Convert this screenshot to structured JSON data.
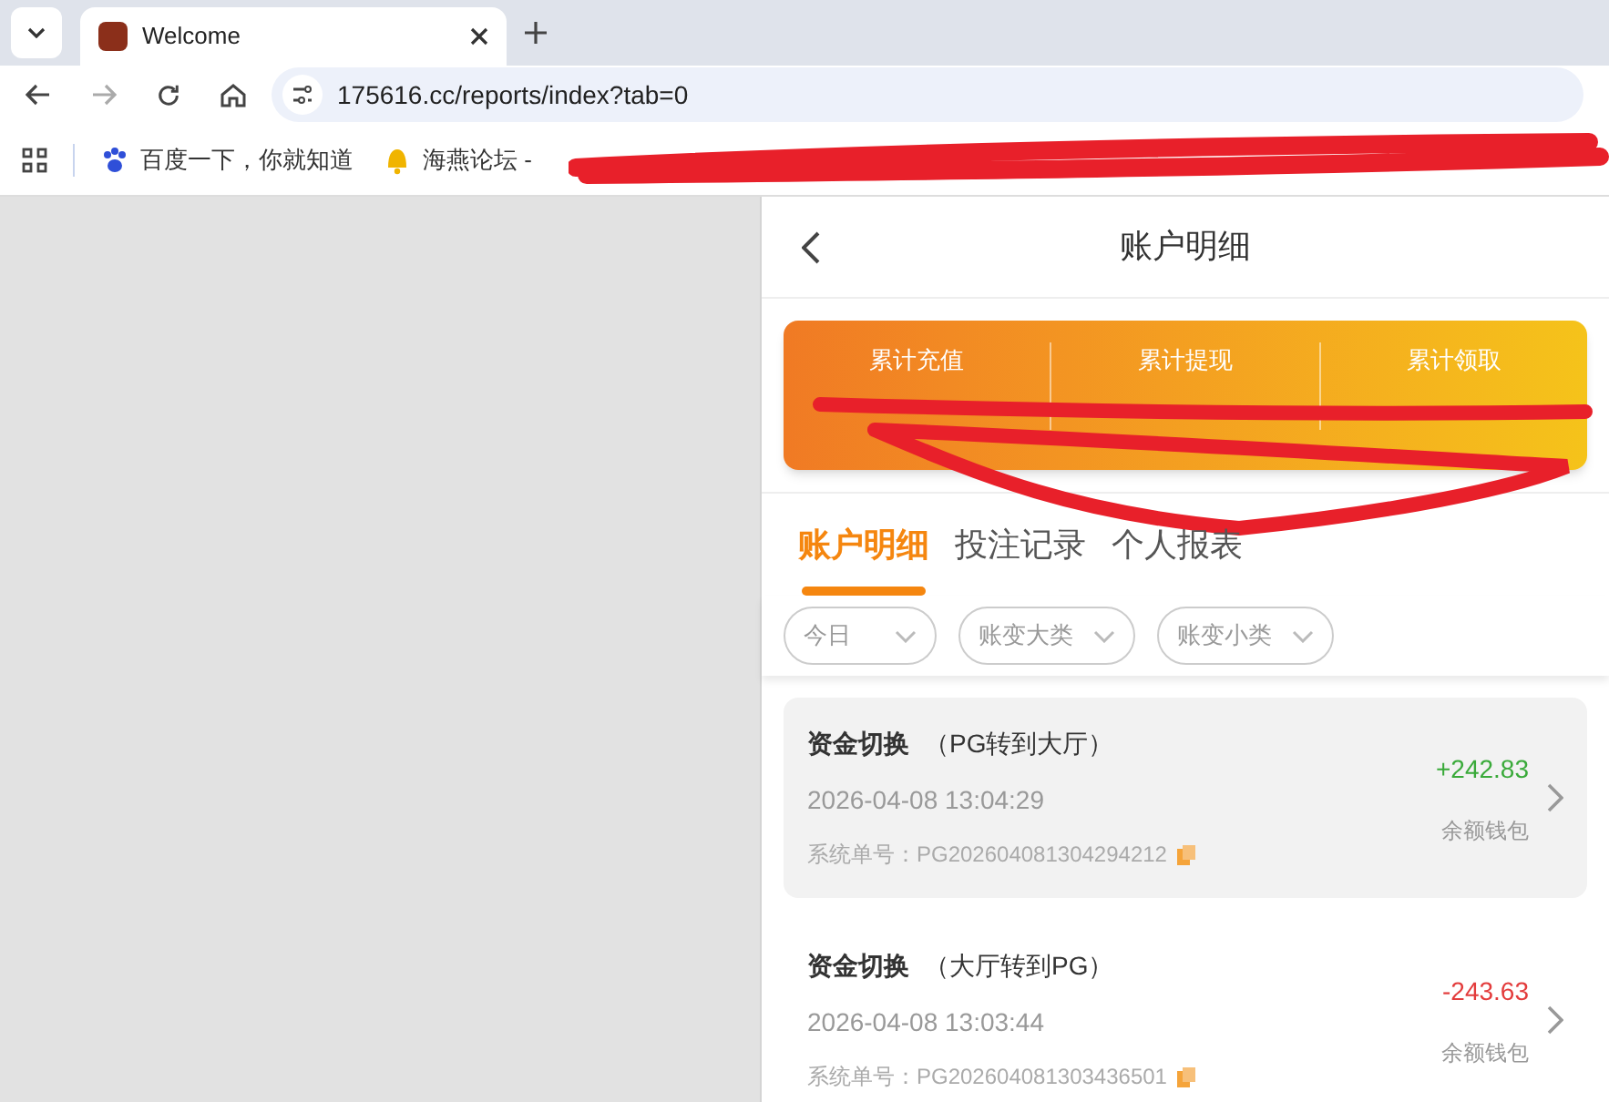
{
  "browser": {
    "tab_title": "Welcome",
    "url": "175616.cc/reports/index?tab=0",
    "bookmarks": [
      "百度一下，你就知道",
      "海燕论坛 -"
    ]
  },
  "page": {
    "title": "账户明细",
    "stats": [
      {
        "label": "累计充值"
      },
      {
        "label": "累计提现"
      },
      {
        "label": "累计领取"
      }
    ],
    "tabs": [
      {
        "label": "账户明细",
        "selected": true
      },
      {
        "label": "投注记录",
        "selected": false
      },
      {
        "label": "个人报表",
        "selected": false
      }
    ],
    "filters": [
      {
        "label": "今日"
      },
      {
        "label": "账变大类"
      },
      {
        "label": "账变小类"
      }
    ],
    "records": [
      {
        "title": "资金切换",
        "detail": "（PG转到大厅）",
        "time": "2026-04-08 13:04:29",
        "order_label": "系统单号：",
        "order_no": "PG202604081304294212",
        "amount": "+242.83",
        "kind": "credit",
        "wallet": "余额钱包",
        "selected": true
      },
      {
        "title": "资金切换",
        "detail": "（大厅转到PG）",
        "time": "2026-04-08 13:03:44",
        "order_label": "系统单号：",
        "order_no": "PG202604081303436501",
        "amount": "-243.63",
        "kind": "debit",
        "wallet": "余额钱包",
        "selected": false
      }
    ]
  }
}
